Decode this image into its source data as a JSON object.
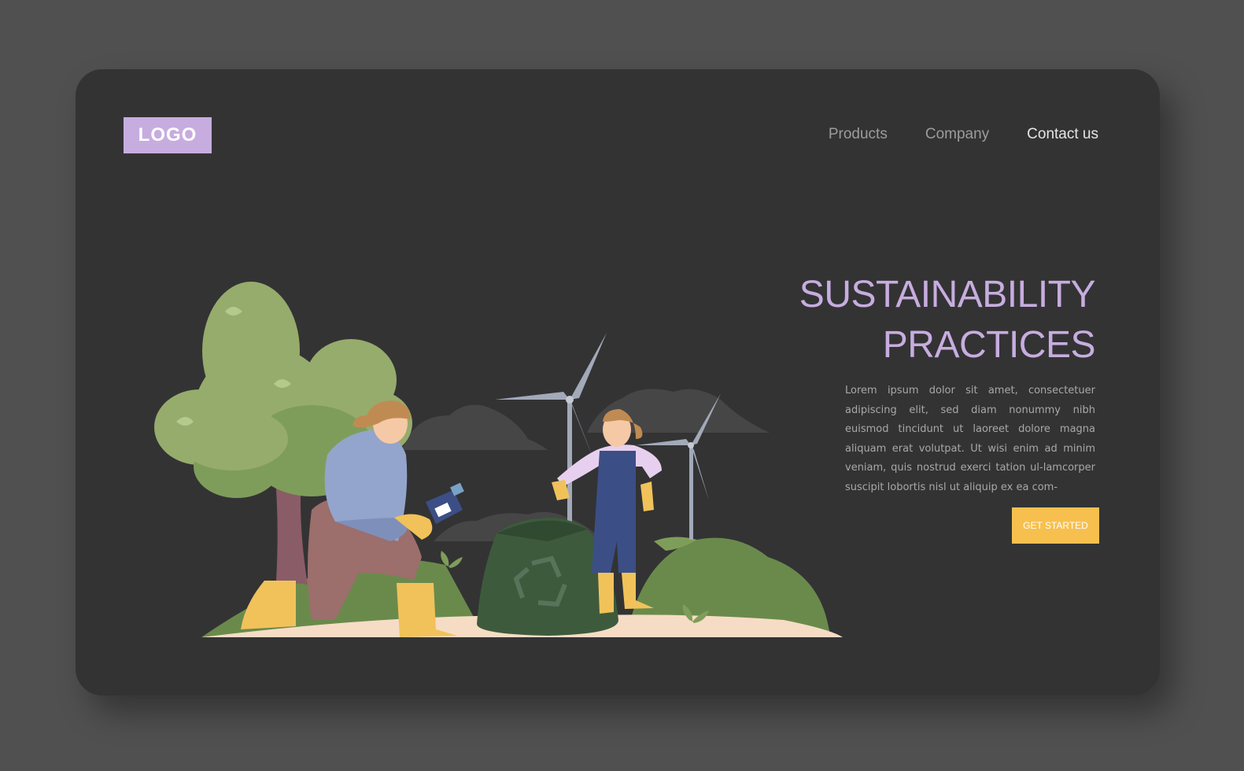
{
  "header": {
    "logo_text": "LOGO",
    "nav": [
      {
        "label": "Products"
      },
      {
        "label": "Company"
      },
      {
        "label": "Contact us"
      }
    ]
  },
  "hero": {
    "title_line1": "SUSTAINABILITY",
    "title_line2": "PRACTICES",
    "body": "Lorem ipsum dolor sit amet, consectetuer adipiscing elit, sed diam nonummy nibh euismod tincidunt ut laoreet dolore magna aliquam erat volutpat. Ut wisi enim ad minim veniam, quis nostrud exerci tation ul-lamcorper suscipit lobortis nisl ut aliquip ex ea com-",
    "cta_label": "GET STARTED"
  },
  "colors": {
    "page_bg": "#505050",
    "card_bg": "#333334",
    "accent_purple": "#c7addf",
    "accent_yellow": "#f7c04e"
  },
  "illustration": {
    "icons": [
      "tree",
      "wind-turbine",
      "recycle-bag",
      "bottle",
      "woman-kneeling",
      "girl-overalls",
      "clouds",
      "sprout"
    ]
  }
}
